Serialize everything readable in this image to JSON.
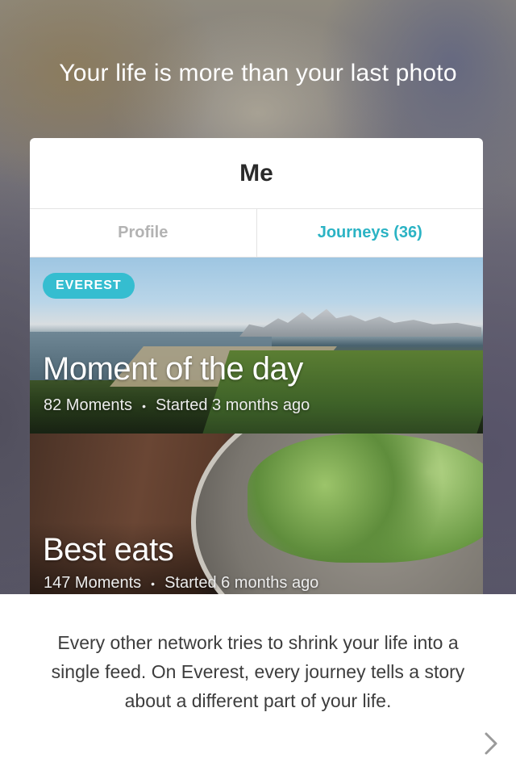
{
  "headline": "Your life is more than your last photo",
  "card": {
    "title": "Me",
    "tabs": [
      {
        "label": "Profile",
        "active": false
      },
      {
        "label": "Journeys (36)",
        "active": true
      }
    ],
    "journeys": [
      {
        "badge": "EVEREST",
        "name": "Moment of the day",
        "moments": "82 Moments",
        "started": "Started 3 months ago"
      },
      {
        "badge": "",
        "name": "Best eats",
        "moments": "147 Moments",
        "started": "Started 6 months ago"
      }
    ],
    "separator": "•"
  },
  "description": "Every other network tries to shrink your life into a single feed. On Everest, every journey tells a story about a different part of your life.",
  "next_icon": "chevron-right-icon",
  "colors": {
    "accent": "#2bb3c4",
    "badge": "#35bdd0",
    "text_dark": "#2a2a2a",
    "tab_inactive": "#b3b3b3"
  }
}
